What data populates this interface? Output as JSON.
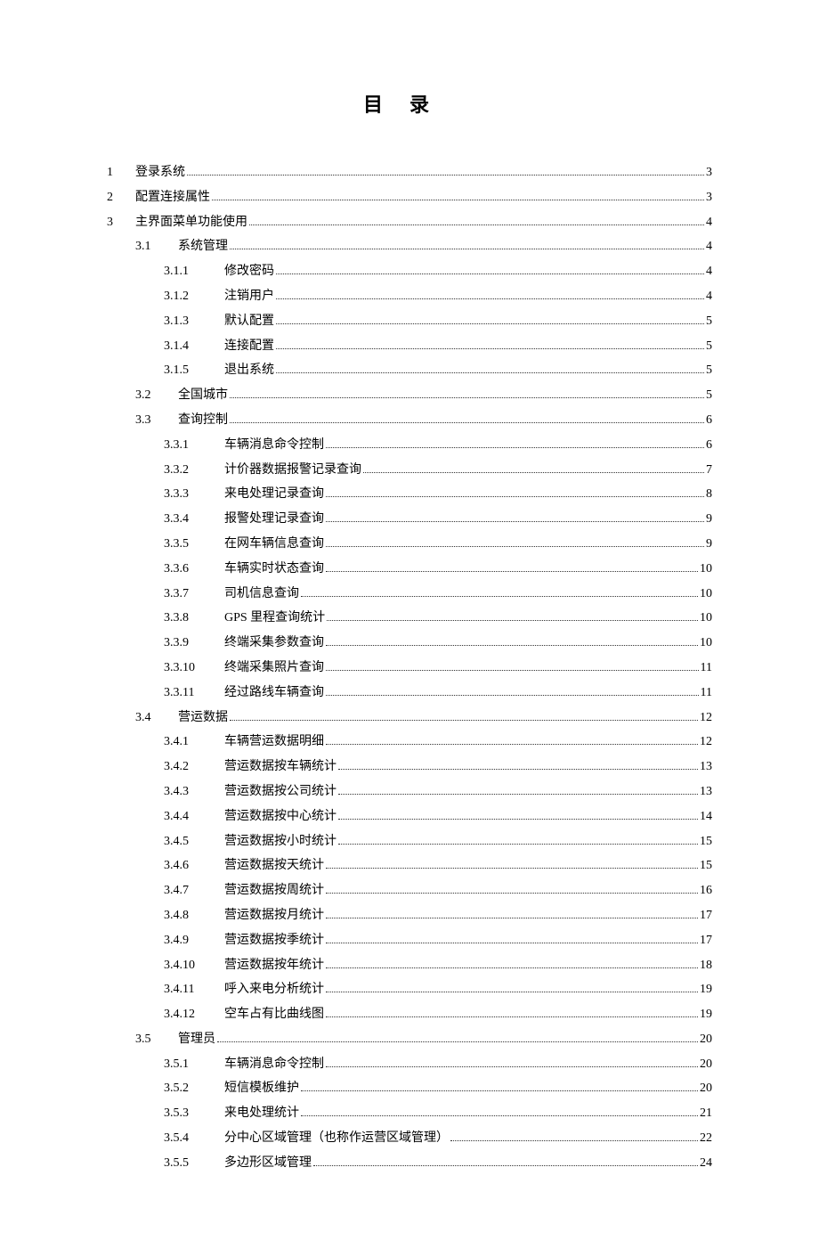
{
  "title": "目录",
  "toc": [
    {
      "level": 1,
      "num": "1",
      "text": "登录系统",
      "page": "3"
    },
    {
      "level": 1,
      "num": "2",
      "text": "配置连接属性",
      "page": "3"
    },
    {
      "level": 1,
      "num": "3",
      "text": "主界面菜单功能使用",
      "page": "4"
    },
    {
      "level": 2,
      "num": "3.1",
      "text": "系统管理",
      "page": "4"
    },
    {
      "level": 3,
      "num": "3.1.1",
      "text": "修改密码",
      "page": "4"
    },
    {
      "level": 3,
      "num": "3.1.2",
      "text": "注销用户",
      "page": "4"
    },
    {
      "level": 3,
      "num": "3.1.3",
      "text": "默认配置",
      "page": "5"
    },
    {
      "level": 3,
      "num": "3.1.4",
      "text": "连接配置",
      "page": "5"
    },
    {
      "level": 3,
      "num": "3.1.5",
      "text": "退出系统",
      "page": "5"
    },
    {
      "level": 2,
      "num": "3.2",
      "text": "全国城市",
      "page": "5"
    },
    {
      "level": 2,
      "num": "3.3",
      "text": "查询控制",
      "page": "6"
    },
    {
      "level": 3,
      "num": "3.3.1",
      "text": "车辆消息命令控制",
      "page": "6"
    },
    {
      "level": 3,
      "num": "3.3.2",
      "text": "计价器数据报警记录查询",
      "page": "7"
    },
    {
      "level": 3,
      "num": "3.3.3",
      "text": "来电处理记录查询",
      "page": "8"
    },
    {
      "level": 3,
      "num": "3.3.4",
      "text": "报警处理记录查询",
      "page": "9"
    },
    {
      "level": 3,
      "num": "3.3.5",
      "text": "在网车辆信息查询",
      "page": "9"
    },
    {
      "level": 3,
      "num": "3.3.6",
      "text": "车辆实时状态查询",
      "page": "10"
    },
    {
      "level": 3,
      "num": "3.3.7",
      "text": "司机信息查询",
      "page": "10"
    },
    {
      "level": 3,
      "num": "3.3.8",
      "text": "GPS 里程查询统计",
      "page": "10"
    },
    {
      "level": 3,
      "num": "3.3.9",
      "text": "终端采集参数查询",
      "page": "10"
    },
    {
      "level": 3,
      "num": "3.3.10",
      "text": "终端采集照片查询",
      "page": "11"
    },
    {
      "level": 3,
      "num": "3.3.11",
      "text": "经过路线车辆查询",
      "page": "11"
    },
    {
      "level": 2,
      "num": "3.4",
      "text": "营运数据",
      "page": "12"
    },
    {
      "level": 3,
      "num": "3.4.1",
      "text": "车辆营运数据明细",
      "page": "12"
    },
    {
      "level": 3,
      "num": "3.4.2",
      "text": "营运数据按车辆统计",
      "page": "13"
    },
    {
      "level": 3,
      "num": "3.4.3",
      "text": "营运数据按公司统计",
      "page": "13"
    },
    {
      "level": 3,
      "num": "3.4.4",
      "text": "营运数据按中心统计",
      "page": "14"
    },
    {
      "level": 3,
      "num": "3.4.5",
      "text": "营运数据按小时统计",
      "page": "15"
    },
    {
      "level": 3,
      "num": "3.4.6",
      "text": "营运数据按天统计",
      "page": "15"
    },
    {
      "level": 3,
      "num": "3.4.7",
      "text": "营运数据按周统计",
      "page": "16"
    },
    {
      "level": 3,
      "num": "3.4.8",
      "text": "营运数据按月统计",
      "page": "17"
    },
    {
      "level": 3,
      "num": "3.4.9",
      "text": "营运数据按季统计",
      "page": "17"
    },
    {
      "level": 3,
      "num": "3.4.10",
      "text": "营运数据按年统计",
      "page": "18"
    },
    {
      "level": 3,
      "num": "3.4.11",
      "text": "呼入来电分析统计",
      "page": "19"
    },
    {
      "level": 3,
      "num": "3.4.12",
      "text": "空车占有比曲线图",
      "page": "19"
    },
    {
      "level": 2,
      "num": "3.5",
      "text": "管理员",
      "page": "20"
    },
    {
      "level": 3,
      "num": "3.5.1",
      "text": "车辆消息命令控制",
      "page": "20"
    },
    {
      "level": 3,
      "num": "3.5.2",
      "text": "短信模板维护",
      "page": "20"
    },
    {
      "level": 3,
      "num": "3.5.3",
      "text": "来电处理统计",
      "page": "21"
    },
    {
      "level": 3,
      "num": "3.5.4",
      "text": "分中心区域管理（也称作运营区域管理）",
      "page": "22"
    },
    {
      "level": 3,
      "num": "3.5.5",
      "text": "多边形区域管理",
      "page": "24"
    }
  ]
}
